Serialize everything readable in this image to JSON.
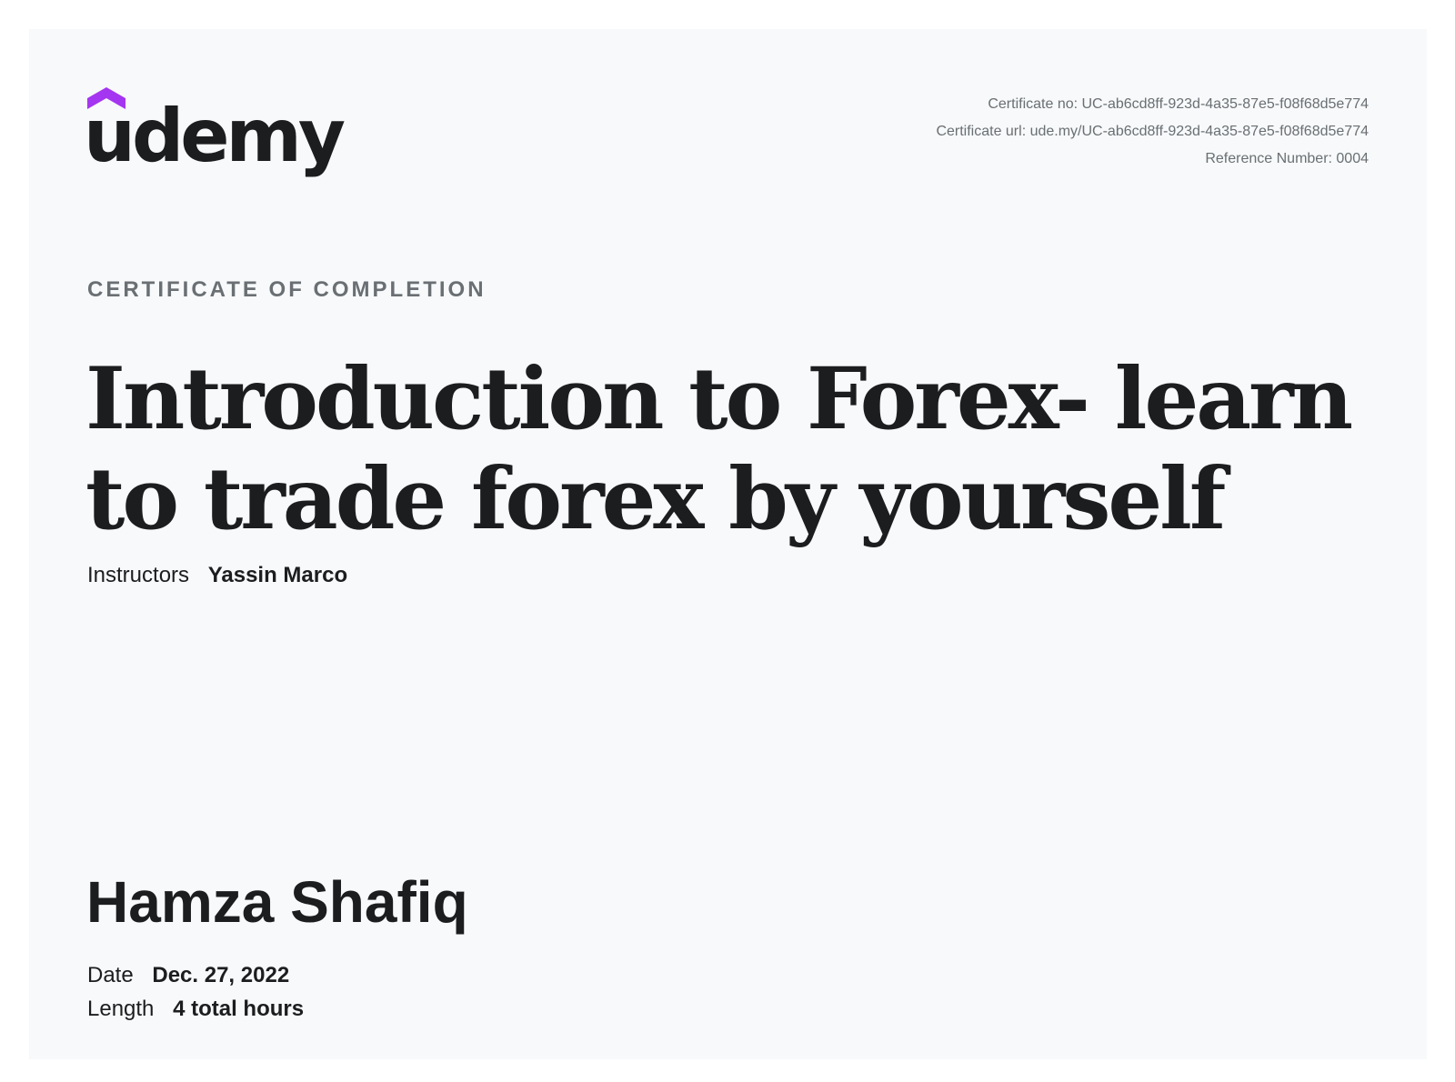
{
  "brand": {
    "name": "udemy",
    "accent_color": "#a435f0",
    "icon": "udemy-hat-icon"
  },
  "meta": {
    "certificate_no_label": "Certificate no: UC-ab6cd8ff-923d-4a35-87e5-f08f68d5e774",
    "certificate_url_label": "Certificate url: ude.my/UC-ab6cd8ff-923d-4a35-87e5-f08f68d5e774",
    "reference_number_label": "Reference Number: 0004"
  },
  "certificate": {
    "eyebrow": "CERTIFICATE OF COMPLETION",
    "course_title": "Introduction to Forex- learn to trade forex by yourself",
    "instructors_label": "Instructors",
    "instructors_value": "Yassin Marco",
    "student_name": "Hamza Shafiq",
    "date_label": "Date",
    "date_value": "Dec. 27, 2022",
    "length_label": "Length",
    "length_value": "4 total hours"
  }
}
